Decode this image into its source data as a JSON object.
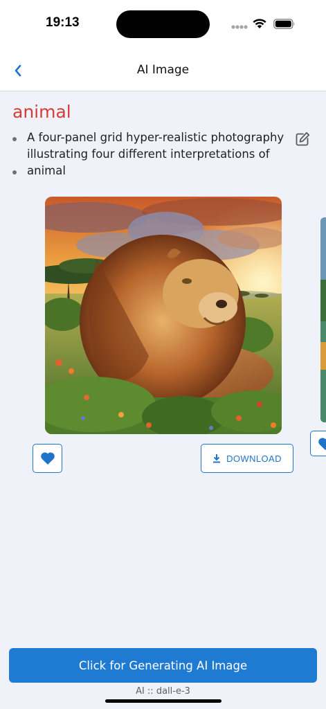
{
  "status_bar": {
    "time": "19:13"
  },
  "nav": {
    "title": "AI Image",
    "back_icon": "chevron-left-icon"
  },
  "prompt": {
    "title": "animal",
    "description": "A four-panel grid hyper-realistic photography illustrating four different interpretations of animal",
    "edit_icon": "edit-icon"
  },
  "gallery": {
    "items": [
      {
        "image": "lion-in-savanna-at-sunset",
        "favorite_icon": "heart-icon",
        "download_label": "DOWNLOAD",
        "download_icon": "download-icon"
      },
      {
        "image": "landscape-peek",
        "favorite_icon": "heart-icon"
      }
    ]
  },
  "footer": {
    "generate_label": "Click for Generating AI Image",
    "model_label": "AI :: dall-e-3"
  },
  "colors": {
    "accent": "#1f7bd2",
    "title_red": "#d43c36",
    "background": "#eff2f8"
  }
}
